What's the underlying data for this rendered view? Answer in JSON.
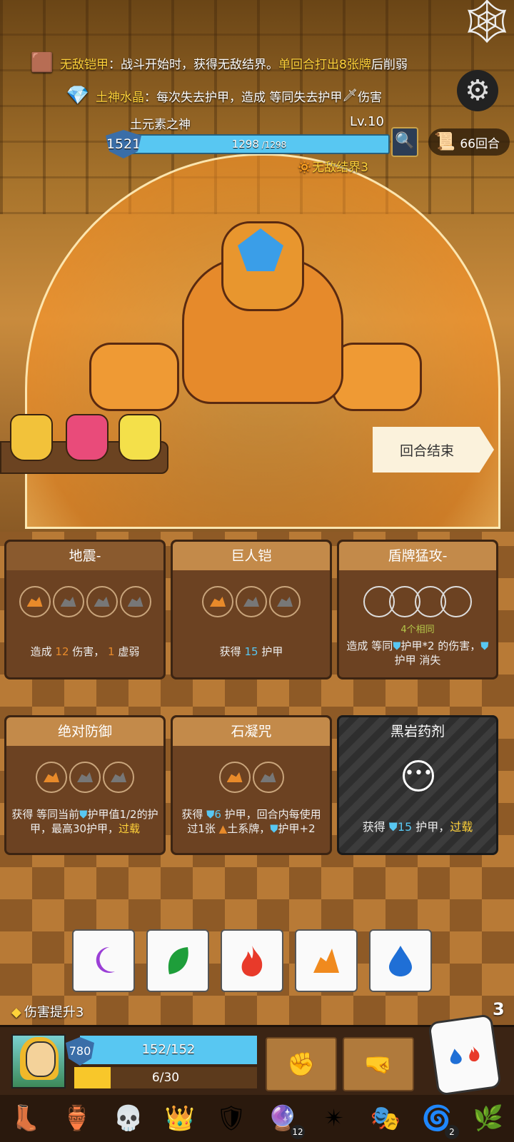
{
  "status_effects": [
    {
      "name": "无敌铠甲",
      "sep": "：",
      "text_a": "战斗开始时，获得无敌结界。",
      "highlight": "单回合打出8张牌",
      "text_b": "后削弱"
    },
    {
      "name": "土神水晶",
      "sep": "：",
      "text_a": "每次失去护甲，造成 等同失去护甲",
      "icon": "sword-icon",
      "text_b": "伤害"
    }
  ],
  "boss": {
    "name": "土元素之神",
    "level": "Lv.10",
    "shield": "1521",
    "hp_current": "1298",
    "hp_max": " /1298",
    "status": "无敌结界3"
  },
  "turn_counter": "66回合",
  "end_turn_label": "回合结束",
  "potions": [
    {
      "name": "potion-yellow",
      "color": "#f2c23a"
    },
    {
      "name": "potion-pink",
      "color": "#e94b7a"
    },
    {
      "name": "potion-yellow-flask",
      "color": "#f4e04a"
    }
  ],
  "cards": [
    {
      "title": "地震-",
      "dice": [
        "earth",
        "earth",
        "earth",
        "earth"
      ],
      "t1": "造成 ",
      "v1": "12",
      "t2": " 伤害， ",
      "v2": "1",
      "t3": " 虚弱"
    },
    {
      "title": "巨人铠",
      "dice": [
        "earth",
        "earth",
        "earth"
      ],
      "t1": "获得 ",
      "v1": "15",
      "t2": " 护甲"
    },
    {
      "title": "盾牌猛攻-",
      "dice": [
        "empty",
        "empty",
        "empty",
        "empty"
      ],
      "note": "4个相同",
      "t1": "造成 等同",
      "t2": "护甲*2 的伤害",
      "t3": "，",
      "t4": "护甲 消失"
    },
    {
      "title": "绝对防御",
      "dice": [
        "earth",
        "earth",
        "earth"
      ],
      "t1": "获得 等同当前",
      "t2": "护甲值1/2的护甲，最高30护甲，",
      "t3": "过载"
    },
    {
      "title": "石凝咒",
      "dice": [
        "earth",
        "earth"
      ],
      "t1": "获得 ",
      "v1": "6",
      "t2": " 护甲，回合内每使用过1张 ",
      "t3": "土系牌，",
      "t4": "护甲+2"
    },
    {
      "title": "黑岩药剂",
      "more": "•••",
      "t1": "获得 ",
      "v1": "15",
      "t2": " 护甲，",
      "t3": "过载"
    }
  ],
  "dice_hand": [
    {
      "type": "moon",
      "color": "#9b3fd6"
    },
    {
      "type": "leaf",
      "color": "#1e9e3a"
    },
    {
      "type": "fire",
      "color": "#e83a2a"
    },
    {
      "type": "earth",
      "color": "#f08a1e"
    },
    {
      "type": "water",
      "color": "#1f6fd6"
    }
  ],
  "buff_label": "伤害提升3",
  "dice_remaining": "3",
  "player": {
    "shield": "780",
    "hp": "152/152",
    "energy": "6/30",
    "energy_fraction": 0.2
  },
  "relics": [
    {
      "name": "boot-relic",
      "glyph": "👢"
    },
    {
      "name": "vase-relic",
      "glyph": "🏺"
    },
    {
      "name": "skull-relic",
      "glyph": "💀"
    },
    {
      "name": "crown-relic",
      "glyph": "👑"
    },
    {
      "name": "shield-relic",
      "glyph": "🛡"
    },
    {
      "name": "orb-relic",
      "glyph": "🔮",
      "count": "12"
    },
    {
      "name": "compass-relic",
      "glyph": "✴"
    },
    {
      "name": "mask-relic",
      "glyph": "🎭"
    },
    {
      "name": "swirl-relic",
      "glyph": "🌀",
      "count": "2"
    },
    {
      "name": "plant-relic",
      "glyph": "🌿"
    }
  ]
}
